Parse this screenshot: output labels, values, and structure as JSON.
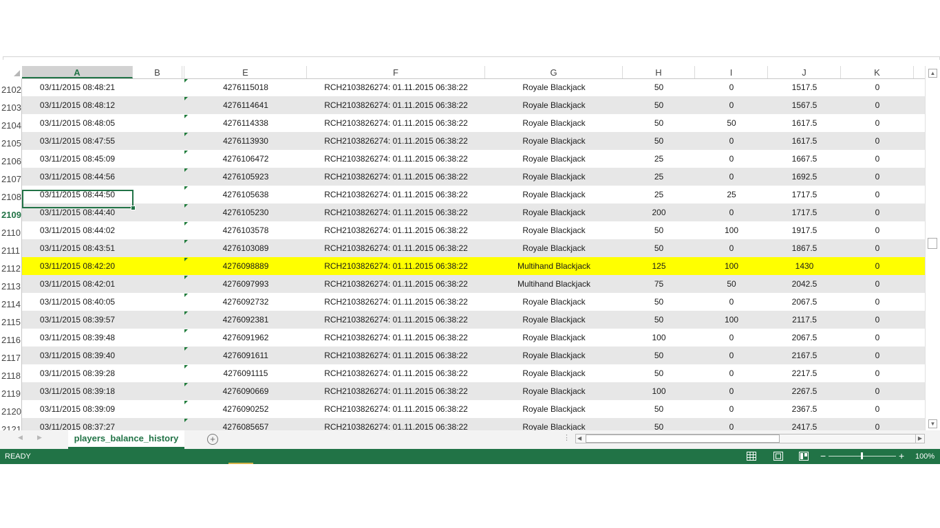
{
  "sheet": {
    "columns": [
      "A",
      "B",
      "E",
      "F",
      "G",
      "H",
      "I",
      "J",
      "K"
    ],
    "active_column": "A",
    "active_row": "2109",
    "rows": [
      {
        "num": "2102",
        "A": "03/11/2015 08:48:21",
        "E": "4276115018",
        "F": "RCH2103826274: 01.11.2015 06:38:22",
        "G": "Royale Blackjack",
        "H": "50",
        "I": "0",
        "J": "1517.5",
        "K": "0"
      },
      {
        "num": "2103",
        "A": "03/11/2015 08:48:12",
        "E": "4276114641",
        "F": "RCH2103826274: 01.11.2015 06:38:22",
        "G": "Royale Blackjack",
        "H": "50",
        "I": "0",
        "J": "1567.5",
        "K": "0"
      },
      {
        "num": "2104",
        "A": "03/11/2015 08:48:05",
        "E": "4276114338",
        "F": "RCH2103826274: 01.11.2015 06:38:22",
        "G": "Royale Blackjack",
        "H": "50",
        "I": "50",
        "J": "1617.5",
        "K": "0"
      },
      {
        "num": "2105",
        "A": "03/11/2015 08:47:55",
        "E": "4276113930",
        "F": "RCH2103826274: 01.11.2015 06:38:22",
        "G": "Royale Blackjack",
        "H": "50",
        "I": "0",
        "J": "1617.5",
        "K": "0"
      },
      {
        "num": "2106",
        "A": "03/11/2015 08:45:09",
        "E": "4276106472",
        "F": "RCH2103826274: 01.11.2015 06:38:22",
        "G": "Royale Blackjack",
        "H": "25",
        "I": "0",
        "J": "1667.5",
        "K": "0"
      },
      {
        "num": "2107",
        "A": "03/11/2015 08:44:56",
        "E": "4276105923",
        "F": "RCH2103826274: 01.11.2015 06:38:22",
        "G": "Royale Blackjack",
        "H": "25",
        "I": "0",
        "J": "1692.5",
        "K": "0"
      },
      {
        "num": "2108",
        "A": "03/11/2015 08:44:50",
        "E": "4276105638",
        "F": "RCH2103826274: 01.11.2015 06:38:22",
        "G": "Royale Blackjack",
        "H": "25",
        "I": "25",
        "J": "1717.5",
        "K": "0"
      },
      {
        "num": "2109",
        "A": "03/11/2015 08:44:40",
        "E": "4276105230",
        "F": "RCH2103826274: 01.11.2015 06:38:22",
        "G": "Royale Blackjack",
        "H": "200",
        "I": "0",
        "J": "1717.5",
        "K": "0"
      },
      {
        "num": "2110",
        "A": "03/11/2015 08:44:02",
        "E": "4276103578",
        "F": "RCH2103826274: 01.11.2015 06:38:22",
        "G": "Royale Blackjack",
        "H": "50",
        "I": "100",
        "J": "1917.5",
        "K": "0"
      },
      {
        "num": "2111",
        "A": "03/11/2015 08:43:51",
        "E": "4276103089",
        "F": "RCH2103826274: 01.11.2015 06:38:22",
        "G": "Royale Blackjack",
        "H": "50",
        "I": "0",
        "J": "1867.5",
        "K": "0"
      },
      {
        "num": "2112",
        "A": "03/11/2015 08:42:20",
        "E": "4276098889",
        "F": "RCH2103826274: 01.11.2015 06:38:22",
        "G": "Multihand Blackjack",
        "H": "125",
        "I": "100",
        "J": "1430",
        "K": "0",
        "highlight": "#ffff00"
      },
      {
        "num": "2113",
        "A": "03/11/2015 08:42:01",
        "E": "4276097993",
        "F": "RCH2103826274: 01.11.2015 06:38:22",
        "G": "Multihand Blackjack",
        "H": "75",
        "I": "50",
        "J": "2042.5",
        "K": "0"
      },
      {
        "num": "2114",
        "A": "03/11/2015 08:40:05",
        "E": "4276092732",
        "F": "RCH2103826274: 01.11.2015 06:38:22",
        "G": "Royale Blackjack",
        "H": "50",
        "I": "0",
        "J": "2067.5",
        "K": "0"
      },
      {
        "num": "2115",
        "A": "03/11/2015 08:39:57",
        "E": "4276092381",
        "F": "RCH2103826274: 01.11.2015 06:38:22",
        "G": "Royale Blackjack",
        "H": "50",
        "I": "100",
        "J": "2117.5",
        "K": "0"
      },
      {
        "num": "2116",
        "A": "03/11/2015 08:39:48",
        "E": "4276091962",
        "F": "RCH2103826274: 01.11.2015 06:38:22",
        "G": "Royale Blackjack",
        "H": "100",
        "I": "0",
        "J": "2067.5",
        "K": "0"
      },
      {
        "num": "2117",
        "A": "03/11/2015 08:39:40",
        "E": "4276091611",
        "F": "RCH2103826274: 01.11.2015 06:38:22",
        "G": "Royale Blackjack",
        "H": "50",
        "I": "0",
        "J": "2167.5",
        "K": "0"
      },
      {
        "num": "2118",
        "A": "03/11/2015 08:39:28",
        "E": "4276091115",
        "F": "RCH2103826274: 01.11.2015 06:38:22",
        "G": "Royale Blackjack",
        "H": "50",
        "I": "0",
        "J": "2217.5",
        "K": "0"
      },
      {
        "num": "2119",
        "A": "03/11/2015 08:39:18",
        "E": "4276090669",
        "F": "RCH2103826274: 01.11.2015 06:38:22",
        "G": "Royale Blackjack",
        "H": "100",
        "I": "0",
        "J": "2267.5",
        "K": "0"
      },
      {
        "num": "2120",
        "A": "03/11/2015 08:39:09",
        "E": "4276090252",
        "F": "RCH2103826274: 01.11.2015 06:38:22",
        "G": "Royale Blackjack",
        "H": "50",
        "I": "0",
        "J": "2367.5",
        "K": "0"
      },
      {
        "num": "2121",
        "A": "03/11/2015 08:37:27",
        "E": "4276085657",
        "F": "RCH2103826274: 01.11.2015 06:38:22",
        "G": "Royale Blackjack",
        "H": "50",
        "I": "0",
        "J": "2417.5",
        "K": "0"
      }
    ]
  },
  "tabs": {
    "active_sheet": "players_balance_history",
    "add_sheet_icon": "plus-circle-icon"
  },
  "status": {
    "text": "READY",
    "zoom": "100%",
    "zoom_fraction": 0.5
  },
  "colors": {
    "accent": "#217346",
    "highlight": "#ffff00",
    "stripe": "#e7e7e7"
  }
}
